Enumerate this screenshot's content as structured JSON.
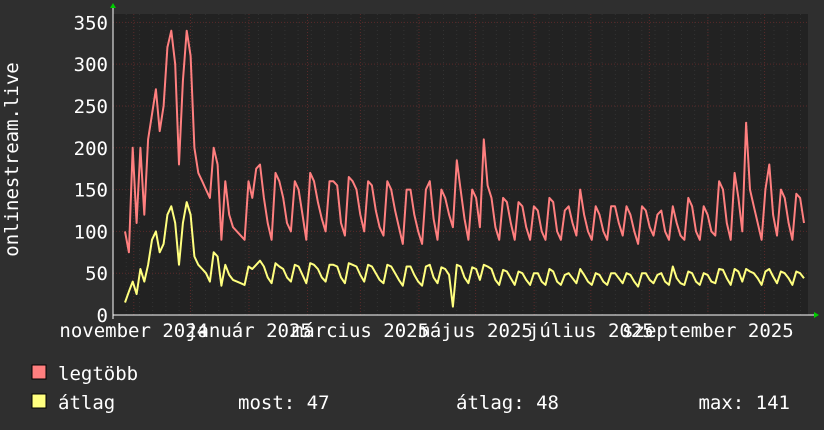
{
  "chart_data": {
    "type": "line",
    "ylabel": "onlinestream.live",
    "ylim": [
      0,
      360
    ],
    "yticks": [
      0,
      50,
      100,
      150,
      200,
      250,
      300,
      350
    ],
    "x_tick_labels": [
      "november 2024",
      "január 2025",
      "március 2025",
      "május 2025",
      "július 2025",
      "szeptember 2025"
    ],
    "x_range": [
      "2024-10-21",
      "2025-10-24"
    ],
    "grid": true,
    "series": [
      {
        "name": "legtöbb",
        "color": "#ff7f7f",
        "values": [
          100,
          75,
          200,
          110,
          200,
          120,
          210,
          240,
          270,
          220,
          250,
          320,
          340,
          300,
          180,
          280,
          340,
          310,
          200,
          170,
          160,
          150,
          140,
          200,
          180,
          90,
          160,
          120,
          105,
          100,
          95,
          90,
          160,
          140,
          175,
          180,
          140,
          110,
          90,
          170,
          160,
          140,
          110,
          100,
          160,
          150,
          120,
          90,
          170,
          160,
          135,
          115,
          100,
          160,
          160,
          155,
          110,
          95,
          165,
          160,
          150,
          120,
          100,
          160,
          155,
          125,
          105,
          95,
          160,
          150,
          125,
          105,
          85,
          150,
          150,
          120,
          100,
          85,
          150,
          160,
          115,
          90,
          150,
          140,
          120,
          105,
          185,
          150,
          115,
          90,
          150,
          140,
          105,
          210,
          155,
          140,
          105,
          90,
          140,
          135,
          110,
          90,
          135,
          130,
          105,
          90,
          130,
          125,
          100,
          90,
          140,
          135,
          100,
          90,
          125,
          130,
          110,
          95,
          150,
          120,
          100,
          90,
          130,
          120,
          100,
          90,
          130,
          130,
          110,
          95,
          130,
          120,
          100,
          85,
          130,
          125,
          105,
          95,
          120,
          125,
          100,
          90,
          130,
          110,
          95,
          90,
          140,
          130,
          100,
          90,
          130,
          120,
          100,
          95,
          160,
          150,
          110,
          90,
          170,
          140,
          100,
          230,
          150,
          130,
          110,
          90,
          150,
          180,
          120,
          95,
          150,
          140,
          110,
          90,
          145,
          140,
          110
        ]
      },
      {
        "name": "átlag",
        "color": "#ffff7f",
        "values": [
          15,
          28,
          40,
          25,
          55,
          40,
          60,
          90,
          100,
          75,
          85,
          120,
          130,
          110,
          60,
          110,
          135,
          120,
          70,
          60,
          55,
          50,
          40,
          75,
          70,
          35,
          60,
          48,
          42,
          40,
          38,
          36,
          58,
          55,
          60,
          65,
          58,
          45,
          38,
          62,
          58,
          55,
          45,
          40,
          60,
          58,
          48,
          38,
          62,
          60,
          55,
          45,
          40,
          60,
          60,
          58,
          45,
          38,
          62,
          60,
          58,
          48,
          40,
          60,
          58,
          50,
          42,
          38,
          60,
          58,
          50,
          42,
          35,
          58,
          58,
          48,
          40,
          35,
          58,
          60,
          45,
          38,
          57,
          55,
          48,
          10,
          60,
          58,
          45,
          38,
          57,
          55,
          42,
          60,
          58,
          55,
          42,
          36,
          54,
          52,
          44,
          36,
          52,
          50,
          42,
          36,
          50,
          50,
          40,
          36,
          55,
          52,
          40,
          36,
          48,
          50,
          44,
          38,
          55,
          48,
          40,
          36,
          50,
          48,
          40,
          36,
          50,
          50,
          44,
          38,
          50,
          48,
          40,
          34,
          50,
          50,
          42,
          38,
          48,
          50,
          40,
          36,
          58,
          44,
          38,
          36,
          52,
          50,
          40,
          36,
          50,
          48,
          40,
          38,
          55,
          54,
          44,
          36,
          55,
          52,
          40,
          55,
          52,
          50,
          44,
          36,
          52,
          55,
          46,
          38,
          52,
          50,
          44,
          36,
          52,
          50,
          44
        ]
      }
    ]
  },
  "legend": {
    "items": [
      {
        "label": "legtöbb",
        "color": "#ff7f7f"
      },
      {
        "label": "átlag",
        "color": "#ffff7f"
      }
    ],
    "stats": {
      "most": "most: 47",
      "atlag": "átlag: 48",
      "max": "max: 141"
    }
  }
}
